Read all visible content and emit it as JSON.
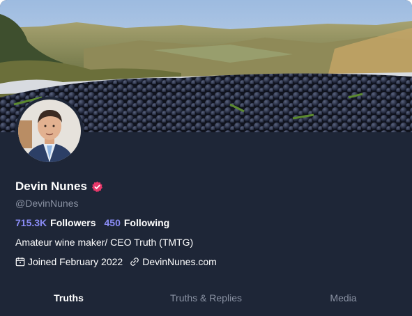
{
  "profile": {
    "display_name": "Devin Nunes",
    "handle": "@DevinNunes",
    "bio": "Amateur wine maker/ CEO Truth (TMTG)",
    "joined": "Joined February 2022",
    "website": "DevinNunes.com",
    "verified_color": "#e8386a"
  },
  "stats": {
    "followers_count": "715.3K",
    "followers_label": "Followers",
    "following_count": "450",
    "following_label": "Following"
  },
  "tabs": [
    {
      "label": "Truths",
      "active": true
    },
    {
      "label": "Truths & Replies",
      "active": false
    },
    {
      "label": "Media",
      "active": false
    }
  ],
  "icons": {
    "verified": "verified-badge-icon",
    "calendar": "calendar-icon",
    "link": "link-icon"
  },
  "colors": {
    "background": "#1e2637",
    "accent": "#8a8cf5",
    "muted": "#8a92a3"
  }
}
